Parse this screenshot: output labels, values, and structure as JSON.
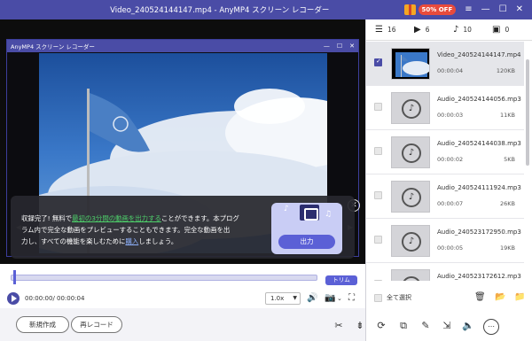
{
  "window": {
    "title": "Video_240524144147.mp4 - AnyMP4 スクリーン レコーダー",
    "sale_badge": "50% OFF"
  },
  "inner_window": {
    "title": "AnyMP4 スクリーン レコーダー"
  },
  "notice": {
    "line1_pre": "収録完了! 無料で",
    "line1_highlight": "最初の3分間の動画を出力する",
    "line1_post": "ことができます。本プログ",
    "line2": "ラム内で完全な動画をプレビューすることもできます。完全な動画を出",
    "line3_pre": "力し、すべての機能を楽しむために",
    "line3_link": "購入",
    "line3_post": "しましょう。",
    "output_button": "出力"
  },
  "timeline": {
    "trim_label": "トリム",
    "progress": 0.0
  },
  "player": {
    "time": "00:00:00/ 00:00:04",
    "speed": "1.0x"
  },
  "bottom_buttons": {
    "new": "新規作成",
    "rerecord": "再レコード"
  },
  "tabs": [
    {
      "icon": "list-icon",
      "count": "16"
    },
    {
      "icon": "video-icon",
      "count": "6"
    },
    {
      "icon": "music-icon",
      "count": "10"
    },
    {
      "icon": "image-icon",
      "count": "0"
    }
  ],
  "files": [
    {
      "name": "Video_240524144147.mp4",
      "duration": "00:00:04",
      "size": "120KB",
      "type": "video",
      "checked": true
    },
    {
      "name": "Audio_240524144056.mp3",
      "duration": "00:00:03",
      "size": "11KB",
      "type": "audio",
      "checked": false
    },
    {
      "name": "Audio_240524144038.mp3",
      "duration": "00:00:02",
      "size": "5KB",
      "type": "audio",
      "checked": false
    },
    {
      "name": "Audio_240524111924.mp3",
      "duration": "00:00:07",
      "size": "26KB",
      "type": "audio",
      "checked": false
    },
    {
      "name": "Audio_240523172950.mp3",
      "duration": "00:00:05",
      "size": "19KB",
      "type": "audio",
      "checked": false
    },
    {
      "name": "Audio_240523172612.mp3",
      "duration": "",
      "size": "",
      "type": "audio",
      "checked": false
    }
  ],
  "select_all": "全て選択",
  "colors": {
    "accent": "#4a4ca6",
    "highlight": "#4ed26b"
  }
}
